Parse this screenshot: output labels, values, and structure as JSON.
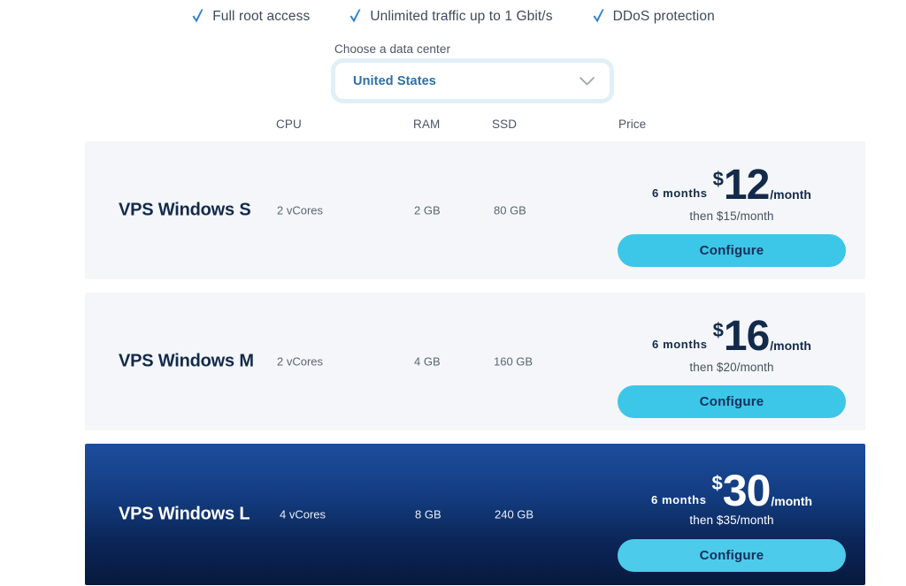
{
  "features": [
    {
      "icon": "check-icon",
      "label": "Full root access"
    },
    {
      "icon": "check-icon",
      "label": "Unlimited traffic up to 1 Gbit/s"
    },
    {
      "icon": "check-icon",
      "label": "DDoS protection"
    }
  ],
  "datacenter": {
    "label": "Choose a data center",
    "selected": "United States",
    "chevron_icon": "chevron-down-icon"
  },
  "table": {
    "headers": {
      "cpu": "CPU",
      "ram": "RAM",
      "ssd": "SSD",
      "price": "Price"
    },
    "rows": [
      {
        "name": "VPS Windows S",
        "cpu": "2 vCores",
        "ram": "2 GB",
        "ssd": "80 GB",
        "term": "6  months",
        "currency": "$",
        "amount": "12",
        "per": "/month",
        "then": "then $15/month",
        "button": "Configure",
        "featured": false
      },
      {
        "name": "VPS Windows M",
        "cpu": "2 vCores",
        "ram": "4 GB",
        "ssd": "160 GB",
        "term": "6  months",
        "currency": "$",
        "amount": "16",
        "per": "/month",
        "then": "then $20/month",
        "button": "Configure",
        "featured": false
      },
      {
        "name": "VPS Windows L",
        "cpu": "4 vCores",
        "ram": "8 GB",
        "ssd": "240 GB",
        "term": "6  months",
        "currency": "$",
        "amount": "30",
        "per": "/month",
        "then": "then $35/month",
        "button": "Configure",
        "featured": true
      }
    ]
  },
  "colors": {
    "accent_cyan": "#3cc6e8",
    "navy": "#132a4a",
    "row_bg": "#f4f6f9",
    "link_blue": "#2f6fa8",
    "check_blue": "#2f7fd0"
  }
}
